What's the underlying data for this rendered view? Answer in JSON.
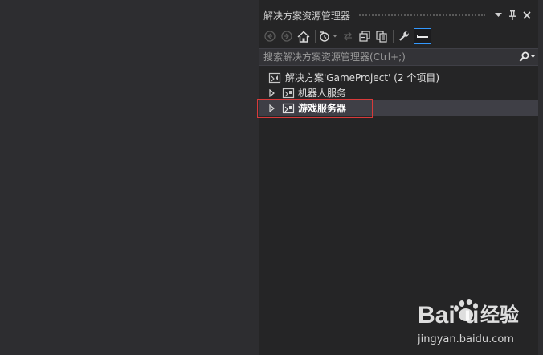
{
  "panel": {
    "title": "解决方案资源管理器"
  },
  "search": {
    "placeholder": "搜索解决方案资源管理器(Ctrl+;)"
  },
  "tree": {
    "solution_label": "解决方案'GameProject' (2 个项目)",
    "items": [
      {
        "label": "机器人服务",
        "bold": false,
        "selected": false
      },
      {
        "label": "游戏服务器",
        "bold": true,
        "selected": true
      }
    ]
  },
  "watermark": {
    "brand_latin": "Bai",
    "brand_latin_end": "u",
    "brand_cn": "经验",
    "url": "jingyan.baidu.com"
  },
  "colors": {
    "panel_bg": "#252526",
    "selection": "#3f3f46",
    "highlight": "#d83a3a",
    "active_button": "#3399ff"
  },
  "icons": {
    "back": "back-arrow-icon",
    "forward": "forward-arrow-icon",
    "home": "home-icon",
    "history": "history-icon",
    "sync": "sync-icon",
    "collapse": "collapse-all-icon",
    "show_all": "show-all-files-icon",
    "properties": "wrench-icon",
    "preview": "preview-icon"
  }
}
